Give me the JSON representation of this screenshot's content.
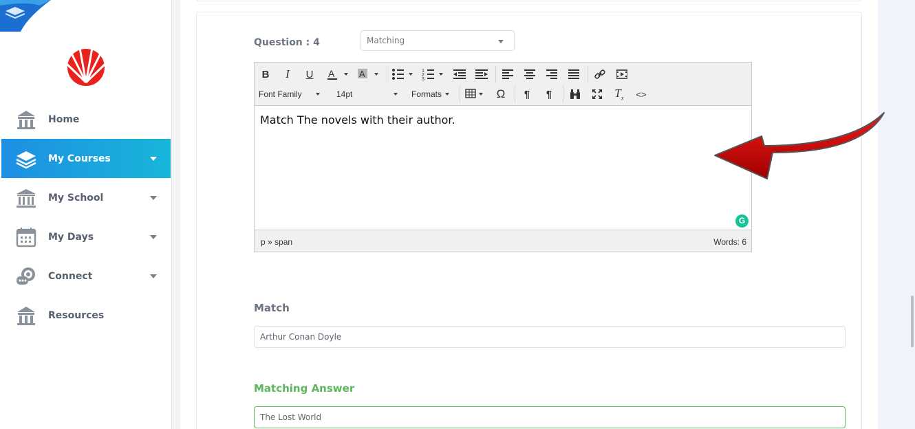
{
  "sidebar": {
    "items": [
      {
        "label": "Home",
        "icon": "bank-icon",
        "active": false
      },
      {
        "label": "My Courses",
        "icon": "layers-icon",
        "active": true
      },
      {
        "label": "My School",
        "icon": "school-icon",
        "active": false
      },
      {
        "label": "My Days",
        "icon": "calendar-icon",
        "active": false
      },
      {
        "label": "Connect",
        "icon": "chat-icon",
        "active": false
      },
      {
        "label": "Resources",
        "icon": "resources-icon",
        "active": false
      }
    ]
  },
  "question": {
    "label": "Question : 4",
    "type_selected": "Matching"
  },
  "editor": {
    "toolbar": {
      "bold": "B",
      "italic": "I",
      "underline": "U",
      "font_family": "Font Family",
      "font_size": "14pt",
      "formats": "Formats"
    },
    "content": "Match The novels with their author.",
    "status_path": "p » span",
    "word_count": "Words: 6"
  },
  "match": {
    "label": "Match",
    "value": "Arthur Conan Doyle"
  },
  "matching_answer": {
    "label": "Matching Answer",
    "value": "The Lost World"
  },
  "colors": {
    "active_nav_start": "#1e8fe4",
    "active_nav_end": "#17b6d9",
    "answer_green": "#5cb85c",
    "arrow_red": "#d10000",
    "logo_red": "#e8231f"
  }
}
